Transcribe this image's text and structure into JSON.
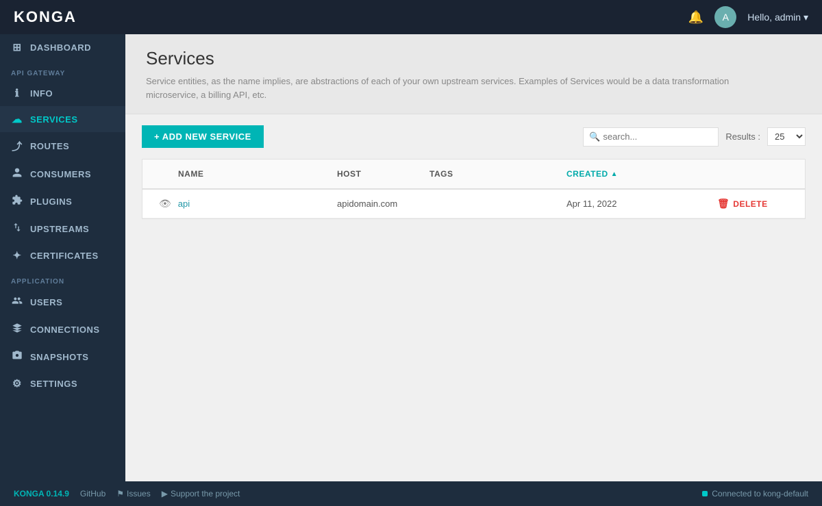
{
  "header": {
    "logo": "KONGA",
    "bell_label": "🔔",
    "user_label": "Hello, admin ▾",
    "avatar_initials": "A"
  },
  "sidebar": {
    "sections": [
      {
        "label": "",
        "items": [
          {
            "id": "dashboard",
            "label": "DASHBOARD",
            "icon": "⊞"
          }
        ]
      },
      {
        "label": "API GATEWAY",
        "items": [
          {
            "id": "info",
            "label": "INFO",
            "icon": "ℹ"
          },
          {
            "id": "services",
            "label": "SERVICES",
            "icon": "☁",
            "active": true
          },
          {
            "id": "routes",
            "label": "ROUTES",
            "icon": "⤴"
          },
          {
            "id": "consumers",
            "label": "CONSUMERS",
            "icon": "👤"
          },
          {
            "id": "plugins",
            "label": "PLUGINS",
            "icon": "🔌"
          },
          {
            "id": "upstreams",
            "label": "UPSTREAMS",
            "icon": "↕"
          },
          {
            "id": "certificates",
            "label": "CERTIFICATES",
            "icon": "✦"
          }
        ]
      },
      {
        "label": "APPLICATION",
        "items": [
          {
            "id": "users",
            "label": "USERS",
            "icon": "👥"
          },
          {
            "id": "connections",
            "label": "CONNECTIONS",
            "icon": "⬡"
          },
          {
            "id": "snapshots",
            "label": "SNAPSHOTS",
            "icon": "📷"
          },
          {
            "id": "settings",
            "label": "SETTINGS",
            "icon": "⚙"
          }
        ]
      }
    ]
  },
  "page": {
    "title": "Services",
    "description": "Service entities, as the name implies, are abstractions of each of your own upstream services. Examples of Services would be a data transformation microservice, a billing API, etc."
  },
  "toolbar": {
    "add_button_label": "+ ADD NEW SERVICE",
    "search_placeholder": "search...",
    "results_label": "Results :",
    "results_value": "25"
  },
  "table": {
    "columns": [
      {
        "id": "name",
        "label": "NAME"
      },
      {
        "id": "host",
        "label": "HOST"
      },
      {
        "id": "tags",
        "label": "TAGS"
      },
      {
        "id": "created",
        "label": "CREATED",
        "active": true,
        "sort": "▲"
      }
    ],
    "rows": [
      {
        "name": "api",
        "host": "apidomain.com",
        "tags": "",
        "created": "Apr 11, 2022",
        "delete_label": "DELETE"
      }
    ]
  },
  "footer": {
    "version": "KONGA 0.14.9",
    "github_label": "GitHub",
    "issues_label": "Issues",
    "support_label": "Support the project",
    "connected_label": "Connected to kong-default"
  }
}
